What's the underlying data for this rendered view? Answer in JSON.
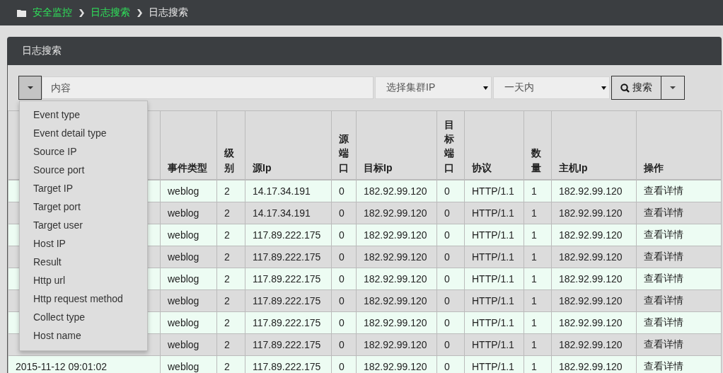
{
  "breadcrumb": [
    {
      "label": "安全监控",
      "current": false
    },
    {
      "label": "日志搜索",
      "current": false
    },
    {
      "label": "日志搜索",
      "current": true
    }
  ],
  "panel": {
    "title": "日志搜索"
  },
  "toolbar": {
    "content_field": {
      "placeholder": "内容"
    },
    "cluster_select": {
      "value": "选择集群IP"
    },
    "time_select": {
      "value": "一天内"
    },
    "search_button": {
      "label": "搜索"
    }
  },
  "field_menu": {
    "expanded": true,
    "items": [
      "Event type",
      "Event detail type",
      "Source IP",
      "Source port",
      "Target IP",
      "Target port",
      "Target user",
      "Host IP",
      "Result",
      "Http url",
      "Http request method",
      "Collect type",
      "Host name"
    ]
  },
  "table": {
    "columns": [
      null,
      "事件类型",
      "级别",
      "源Ip",
      "源端口",
      "目标Ip",
      "目标端口",
      "协议",
      "数量",
      "主机Ip",
      "操作"
    ],
    "rows": [
      [
        null,
        "weblog",
        "2",
        "14.17.34.191",
        "0",
        "182.92.99.120",
        "0",
        "HTTP/1.1",
        "1",
        "182.92.99.120",
        "查看详情"
      ],
      [
        null,
        "weblog",
        "2",
        "14.17.34.191",
        "0",
        "182.92.99.120",
        "0",
        "HTTP/1.1",
        "1",
        "182.92.99.120",
        "查看详情"
      ],
      [
        null,
        "weblog",
        "2",
        "117.89.222.175",
        "0",
        "182.92.99.120",
        "0",
        "HTTP/1.1",
        "1",
        "182.92.99.120",
        "查看详情"
      ],
      [
        null,
        "weblog",
        "2",
        "117.89.222.175",
        "0",
        "182.92.99.120",
        "0",
        "HTTP/1.1",
        "1",
        "182.92.99.120",
        "查看详情"
      ],
      [
        null,
        "weblog",
        "2",
        "117.89.222.175",
        "0",
        "182.92.99.120",
        "0",
        "HTTP/1.1",
        "1",
        "182.92.99.120",
        "查看详情"
      ],
      [
        null,
        "weblog",
        "2",
        "117.89.222.175",
        "0",
        "182.92.99.120",
        "0",
        "HTTP/1.1",
        "1",
        "182.92.99.120",
        "查看详情"
      ],
      [
        null,
        "weblog",
        "2",
        "117.89.222.175",
        "0",
        "182.92.99.120",
        "0",
        "HTTP/1.1",
        "1",
        "182.92.99.120",
        "查看详情"
      ],
      [
        null,
        "weblog",
        "2",
        "117.89.222.175",
        "0",
        "182.92.99.120",
        "0",
        "HTTP/1.1",
        "1",
        "182.92.99.120",
        "查看详情"
      ],
      [
        "2015-11-12 09:01:02",
        "weblog",
        "2",
        "117.89.222.175",
        "0",
        "182.92.99.120",
        "0",
        "HTTP/1.1",
        "1",
        "182.92.99.120",
        "查看详情"
      ]
    ]
  }
}
